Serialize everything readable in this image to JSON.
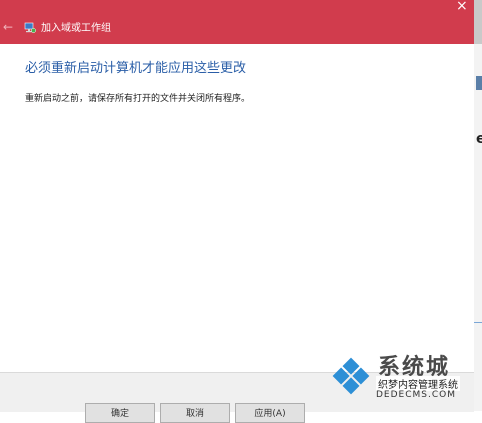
{
  "window": {
    "title": "加入域或工作组",
    "back_glyph": "←",
    "close_glyph": "×",
    "app_icon": "computer-network-icon",
    "accent_color": "#d13c4d"
  },
  "content": {
    "heading": "必须重新启动计算机才能应用这些更改",
    "message": "重新启动之前，请保存所有打开的文件并关闭所有程序。"
  },
  "footer": {
    "buttons": [
      "确定",
      "取消",
      "应用(A)"
    ]
  },
  "watermark": {
    "brand": "系统城",
    "site_cn": "织梦内容管理系统",
    "url": "DEDECMS.COM",
    "logo_icon": "windows-logo-icon"
  },
  "background_window": {
    "edge_letter": "e"
  }
}
